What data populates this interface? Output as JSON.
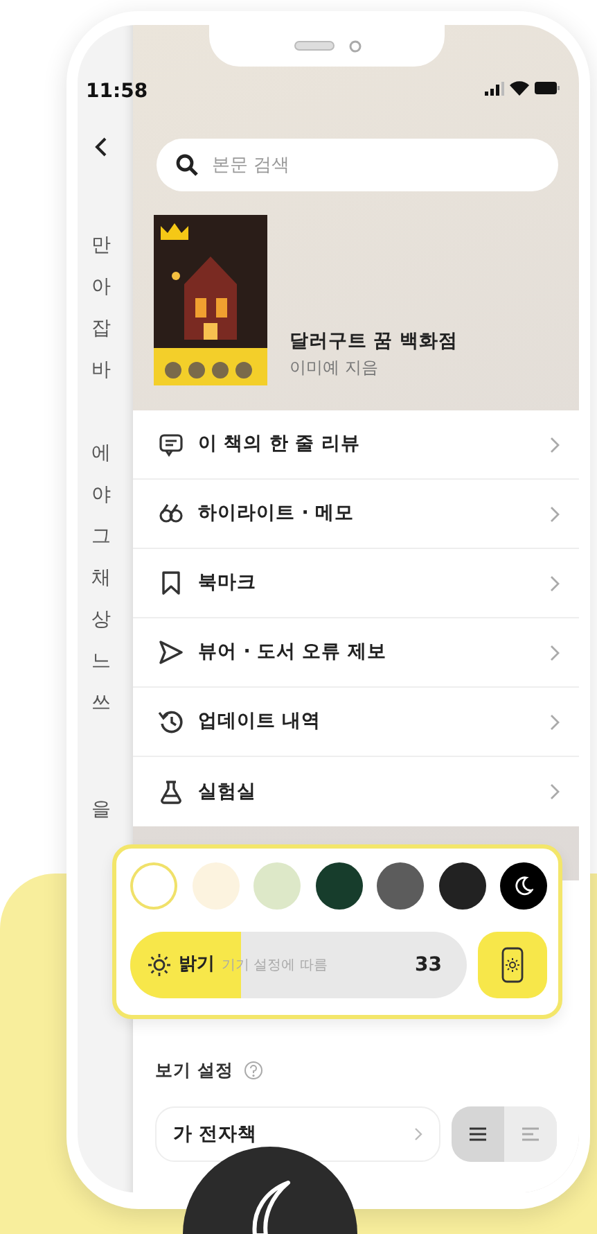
{
  "status_bar": {
    "time": "11:58"
  },
  "reader": {
    "paragraphs": [
      [
        "만",
        "아",
        "잡",
        "바"
      ],
      [
        "에",
        "야",
        "그",
        "채",
        "상",
        "느",
        "쓰"
      ],
      [
        "을"
      ]
    ]
  },
  "search": {
    "placeholder": "본문 검색"
  },
  "book": {
    "title": "달러구트 꿈 백화점",
    "author": "이미예 지음"
  },
  "menu": [
    {
      "kind": "review",
      "label": "이 책의 한 줄 리뷰"
    },
    {
      "kind": "highlight",
      "label": "하이라이트 · 메모"
    },
    {
      "kind": "bookmark",
      "label": "북마크"
    },
    {
      "kind": "report",
      "label": "뷰어 · 도서 오류 제보"
    },
    {
      "kind": "history",
      "label": "업데이트 내역"
    },
    {
      "kind": "lab",
      "label": "실험실"
    }
  ],
  "theme_colors": [
    {
      "kind": "swatch",
      "color": "#ffffff",
      "selected": true
    },
    {
      "kind": "swatch",
      "color": "#fcf3df",
      "selected": false
    },
    {
      "kind": "swatch",
      "color": "#dde8c8",
      "selected": false
    },
    {
      "kind": "swatch",
      "color": "#173d2c",
      "selected": false
    },
    {
      "kind": "swatch",
      "color": "#5c5c5c",
      "selected": false
    },
    {
      "kind": "swatch",
      "color": "#222222",
      "selected": false
    },
    {
      "kind": "night",
      "color": "#000000",
      "selected": false
    }
  ],
  "brightness": {
    "label": "밝기",
    "hint": "기기 설정에 따름",
    "level": 0.33,
    "reading": "33",
    "auto": true
  },
  "view_settings": {
    "title": "보기 설정",
    "font_button": "가 전자책",
    "layouts": [
      {
        "kind": "justified",
        "selected": true
      },
      {
        "kind": "ragged",
        "selected": false
      }
    ]
  }
}
